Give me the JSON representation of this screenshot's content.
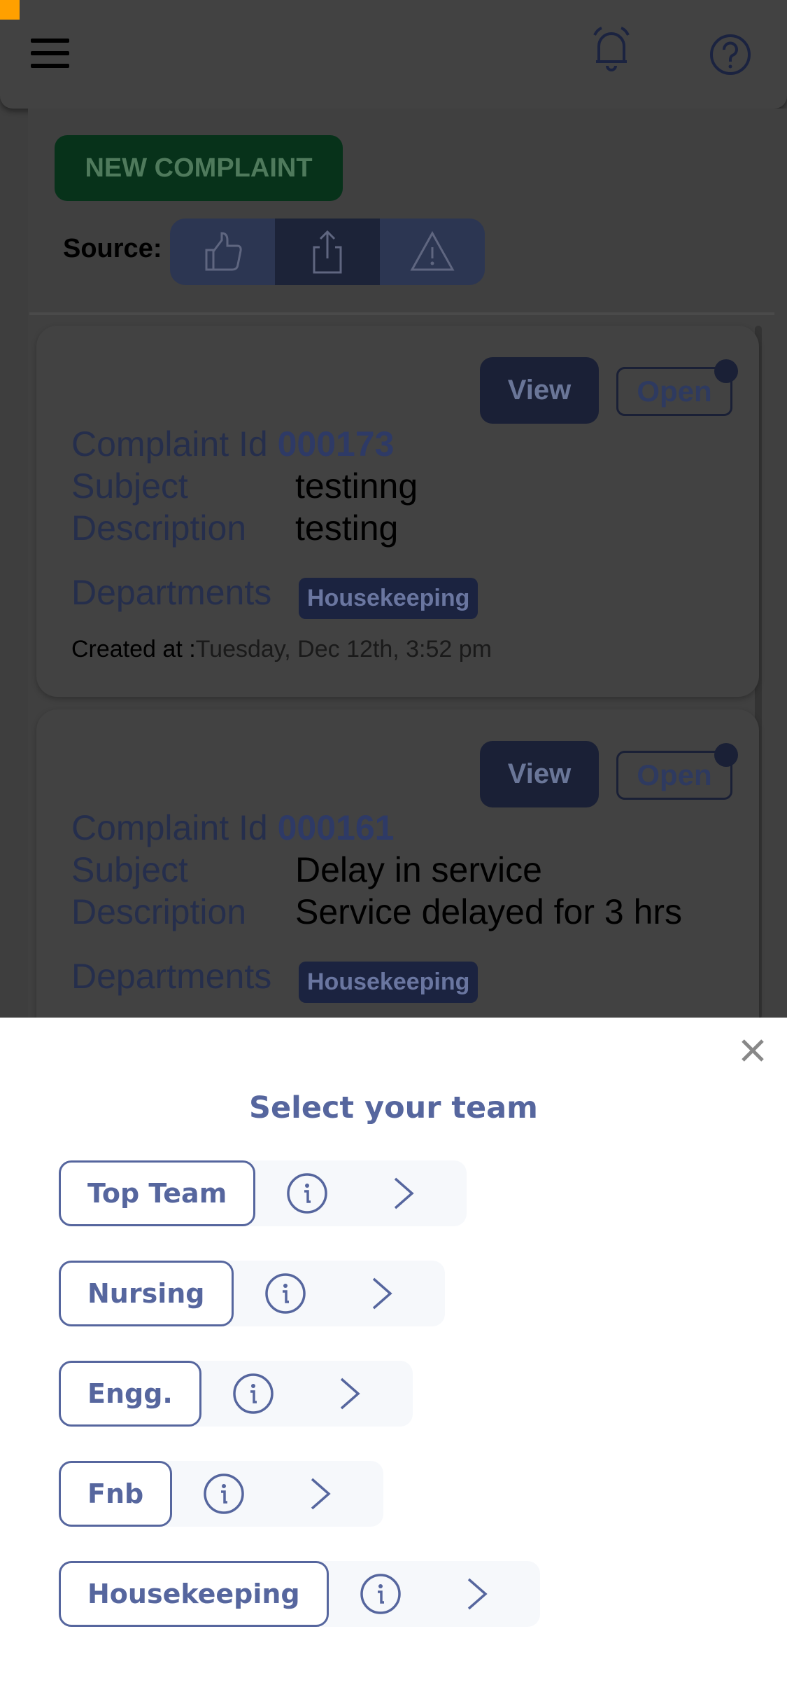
{
  "header": {
    "menu_icon": "hamburger-icon",
    "bell_icon": "bell-icon",
    "help_icon": "help-circle-icon"
  },
  "toolbar": {
    "new_complaint_label": "NEW COMPLAINT",
    "source_label": "Source:",
    "source_options": [
      "thumbs-up-icon",
      "share-upload-icon",
      "warning-icon"
    ],
    "selected_source": 1
  },
  "complaints": [
    {
      "view_label": "View",
      "status": "Open",
      "id_label": "Complaint Id",
      "id": "000173",
      "subject_label": "Subject",
      "subject": "testinng",
      "description_label": "Description",
      "description": "testing",
      "departments_label": "Departments",
      "department": "Housekeeping",
      "created_label": "Created at :",
      "created": "Tuesday, Dec 12th, 3:52 pm"
    },
    {
      "view_label": "View",
      "status": "Open",
      "id_label": "Complaint Id",
      "id": "000161",
      "subject_label": "Subject",
      "subject": "Delay in service",
      "description_label": "Description",
      "description": "Service delayed for 3 hrs",
      "departments_label": "Departments",
      "department": "Housekeeping"
    }
  ],
  "sheet": {
    "title": "Select your team",
    "close_icon": "close-icon",
    "teams": [
      "Top Team",
      "Nursing",
      "Engg.",
      "Fnb",
      "Housekeeping"
    ]
  },
  "colors": {
    "accent": "#56669e",
    "primary_navy": "#24336b",
    "success_green": "#0a8a3a",
    "status_bar_orange": "#ffa000"
  }
}
